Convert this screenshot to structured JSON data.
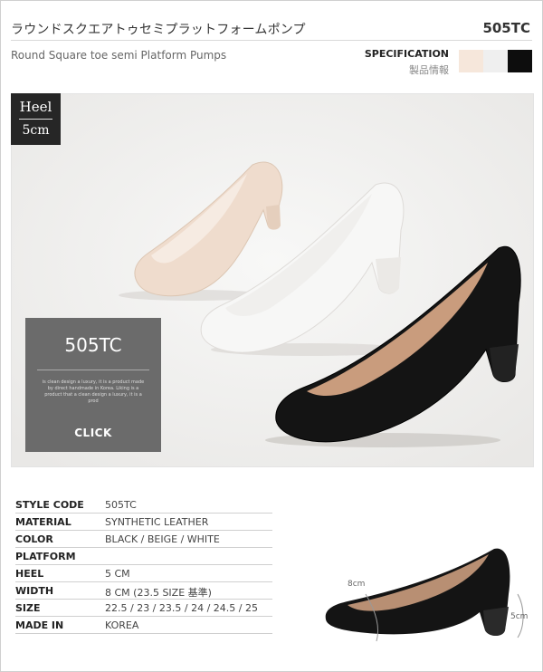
{
  "header": {
    "title_jp": "ラウンドスクエアトゥセミプラットフォームポンプ",
    "style_code": "505TC",
    "title_en": "Round Square toe semi Platform Pumps"
  },
  "specification": {
    "label": "SPECIFICATION",
    "sub_label": "製品情報",
    "swatches": [
      {
        "name": "beige",
        "color": "#f6e7db"
      },
      {
        "name": "white",
        "color": "#efefef"
      },
      {
        "name": "black",
        "color": "#0d0d0d"
      }
    ]
  },
  "heel_badge": {
    "line1": "Heel",
    "line2": "5cm"
  },
  "promo": {
    "code": "505TC",
    "tagline": "is clean design a luxury, it is a product made by direct handmade in Korea. Liking is a product that a clean design a luxury, it is a prod",
    "cta": "CLICK"
  },
  "specs": [
    {
      "key": "STYLE CODE",
      "value": "505TC"
    },
    {
      "key": "MATERIAL",
      "value": "SYNTHETIC LEATHER"
    },
    {
      "key": "COLOR",
      "value": "BLACK / BEIGE / WHITE"
    },
    {
      "key": "PLATFORM",
      "value": ""
    },
    {
      "key": "HEEL",
      "value": "5 CM"
    },
    {
      "key": "WIDTH",
      "value": "8 CM (23.5 SIZE 基準)"
    },
    {
      "key": "SIZE",
      "value": "22.5 / 23 / 23.5 / 24 / 24.5 / 25"
    },
    {
      "key": "MADE IN",
      "value": "KOREA"
    }
  ],
  "diagram": {
    "width_label": "8cm",
    "heel_label": "5cm"
  },
  "colors": {
    "beige_shoe": "#efdccd",
    "white_shoe": "#f7f7f6",
    "black_shoe": "#141414",
    "promo_bg": "#6b6b6b"
  }
}
